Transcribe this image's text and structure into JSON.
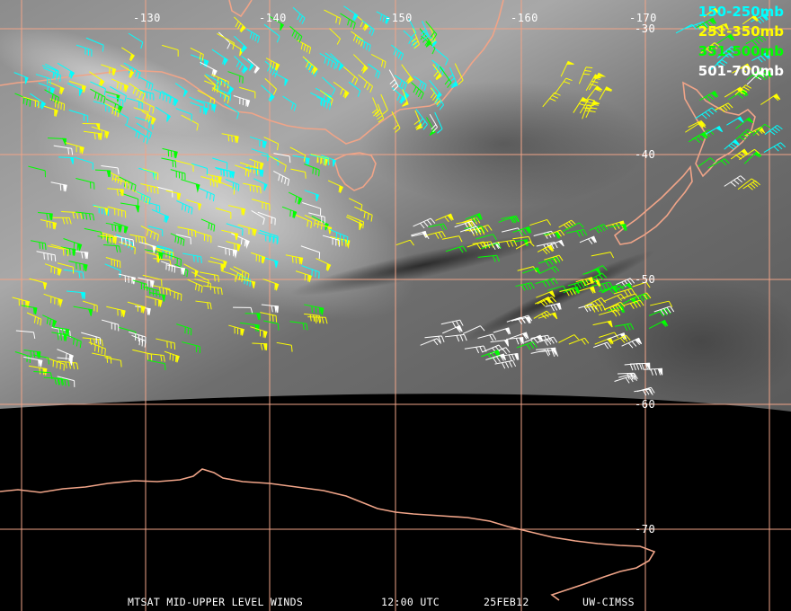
{
  "legend": [
    {
      "label": "150-250mb",
      "color": "#00ffff"
    },
    {
      "label": "251-350mb",
      "color": "#ffff00"
    },
    {
      "label": "351-500mb",
      "color": "#00ff00"
    },
    {
      "label": "501-700mb",
      "color": "#ffffff"
    }
  ],
  "longitude_labels": [
    "-130",
    "-140",
    "-150",
    "-160",
    "-170"
  ],
  "latitude_labels": [
    "-30",
    "-40",
    "-50",
    "-60",
    "-70"
  ],
  "footer": {
    "product": "MTSAT MID-UPPER LEVEL WINDS",
    "time": "12:00 UTC",
    "date": "25FEB12",
    "source": "UW-CIMSS"
  },
  "colors": {
    "grid": "#f0a488",
    "coastline": "#f0a488",
    "background": "#000000",
    "cloud_imagery": "#9a9a9a"
  }
}
